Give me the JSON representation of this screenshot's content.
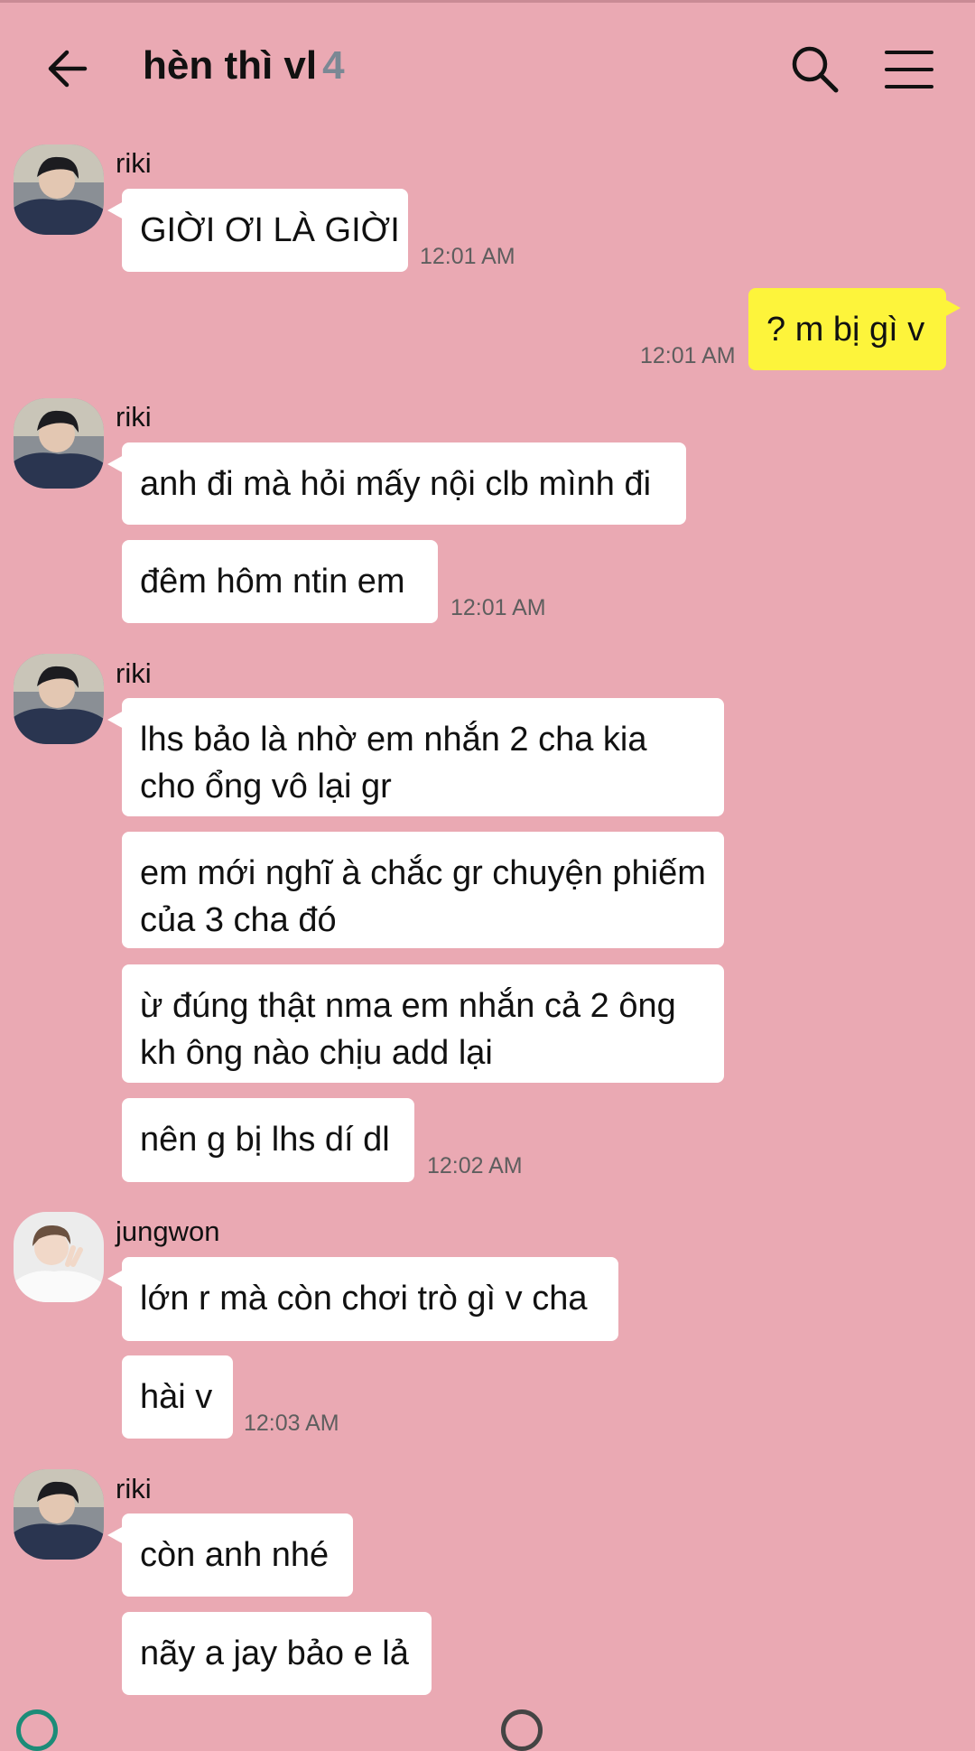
{
  "header": {
    "title": "hèn thì vl",
    "member_count": "4",
    "icons": {
      "back": "arrow-left-icon",
      "search": "search-icon",
      "menu": "hamburger-menu-icon"
    }
  },
  "colors": {
    "background": "#eaa9b3",
    "own_bubble": "#fdf43b",
    "other_bubble": "#ffffff",
    "timestamp": "#5e5e5e",
    "member_count": "#7a8894"
  },
  "messages": [
    {
      "sender": "riki",
      "text": "GIỜI ƠI LÀ GIỜI",
      "time": "12:01 AM"
    },
    {
      "sender": "me",
      "text": "? m bị gì v",
      "time": "12:01 AM"
    },
    {
      "sender": "riki",
      "text": "anh đi mà hỏi mấy nội clb mình đi"
    },
    {
      "sender": "riki",
      "text": "đêm hôm ntin em",
      "time": "12:01 AM"
    },
    {
      "sender": "riki",
      "text": "lhs bảo là nhờ em nhắn 2 cha kia cho ổng vô lại gr"
    },
    {
      "sender": "riki",
      "text": "em mới nghĩ à chắc gr chuyện phiếm của 3 cha đó"
    },
    {
      "sender": "riki",
      "text": "ừ đúng thật nma em nhắn cả 2 ông kh ông nào chịu add lại"
    },
    {
      "sender": "riki",
      "text": "nên g bị lhs dí dl",
      "time": "12:02 AM"
    },
    {
      "sender": "jungwon",
      "text": "lớn r mà còn chơi trò gì v cha"
    },
    {
      "sender": "jungwon",
      "text": "hài v",
      "time": "12:03 AM"
    },
    {
      "sender": "riki",
      "text": "còn anh nhé"
    },
    {
      "sender": "riki",
      "text": "nãy a jay bảo e lả"
    }
  ]
}
